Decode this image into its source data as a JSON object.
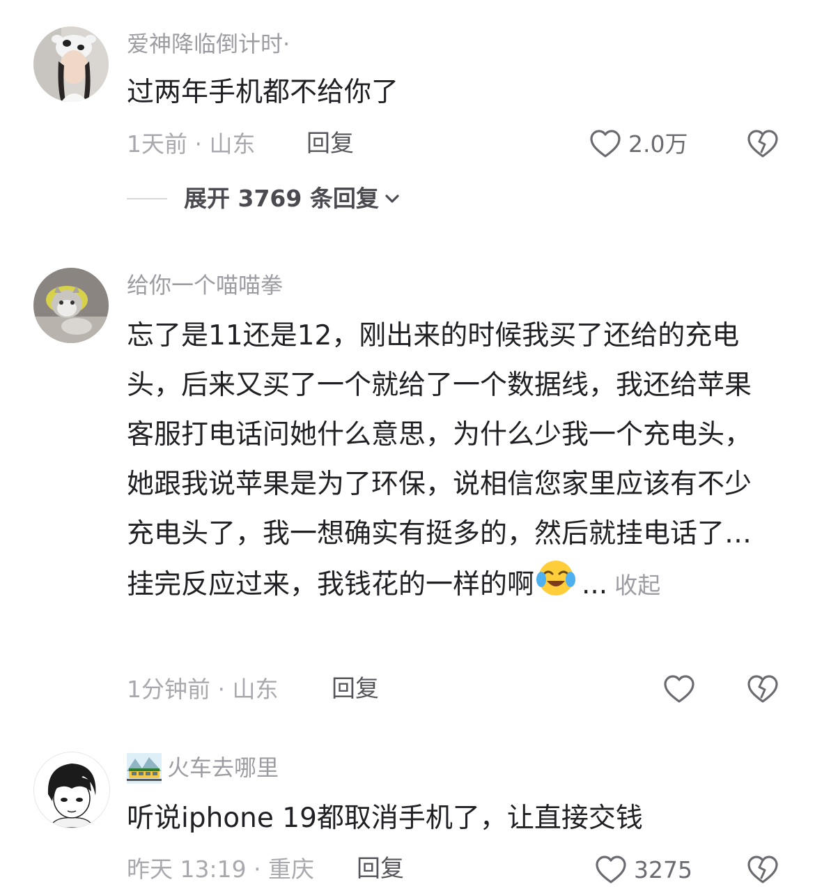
{
  "comments": [
    {
      "username": "爱神降临倒计时·",
      "text": "过两年手机都不给你了",
      "time_location": "1天前 · 山东",
      "reply_label": "回复",
      "like_count": "2.0万",
      "expand_label": "展开 3769 条回复"
    },
    {
      "username": "给你一个喵喵拳",
      "text": "忘了是11还是12，刚出来的时候我买了还给的充电头，后来又买了一个就给了一个数据线，我还给苹果客服打电话问她什么意思，为什么少我一个充电头，她跟我说苹果是为了环保，说相信您家里应该有不少充电头了，我一想确实有挺多的，然后就挂电话了…挂完反应过来，我钱花的一样的啊",
      "ellipsis": "...",
      "collapse_label": "收起",
      "time_location": "1分钟前 · 山东",
      "reply_label": "回复"
    },
    {
      "username": "火车去哪里",
      "text": "听说iphone 19都取消手机了，让直接交钱",
      "time_location": "昨天 13:19 · 重庆",
      "reply_label": "回复",
      "like_count": "3275"
    }
  ],
  "colors": {
    "text_primary": "#1f1f24",
    "text_secondary": "#9c9ca3",
    "background": "#ffffff"
  },
  "icons": [
    "heart-outline-icon",
    "broken-heart-icon",
    "chevron-down-icon",
    "crying-laughing-emoji",
    "train-emoji"
  ]
}
